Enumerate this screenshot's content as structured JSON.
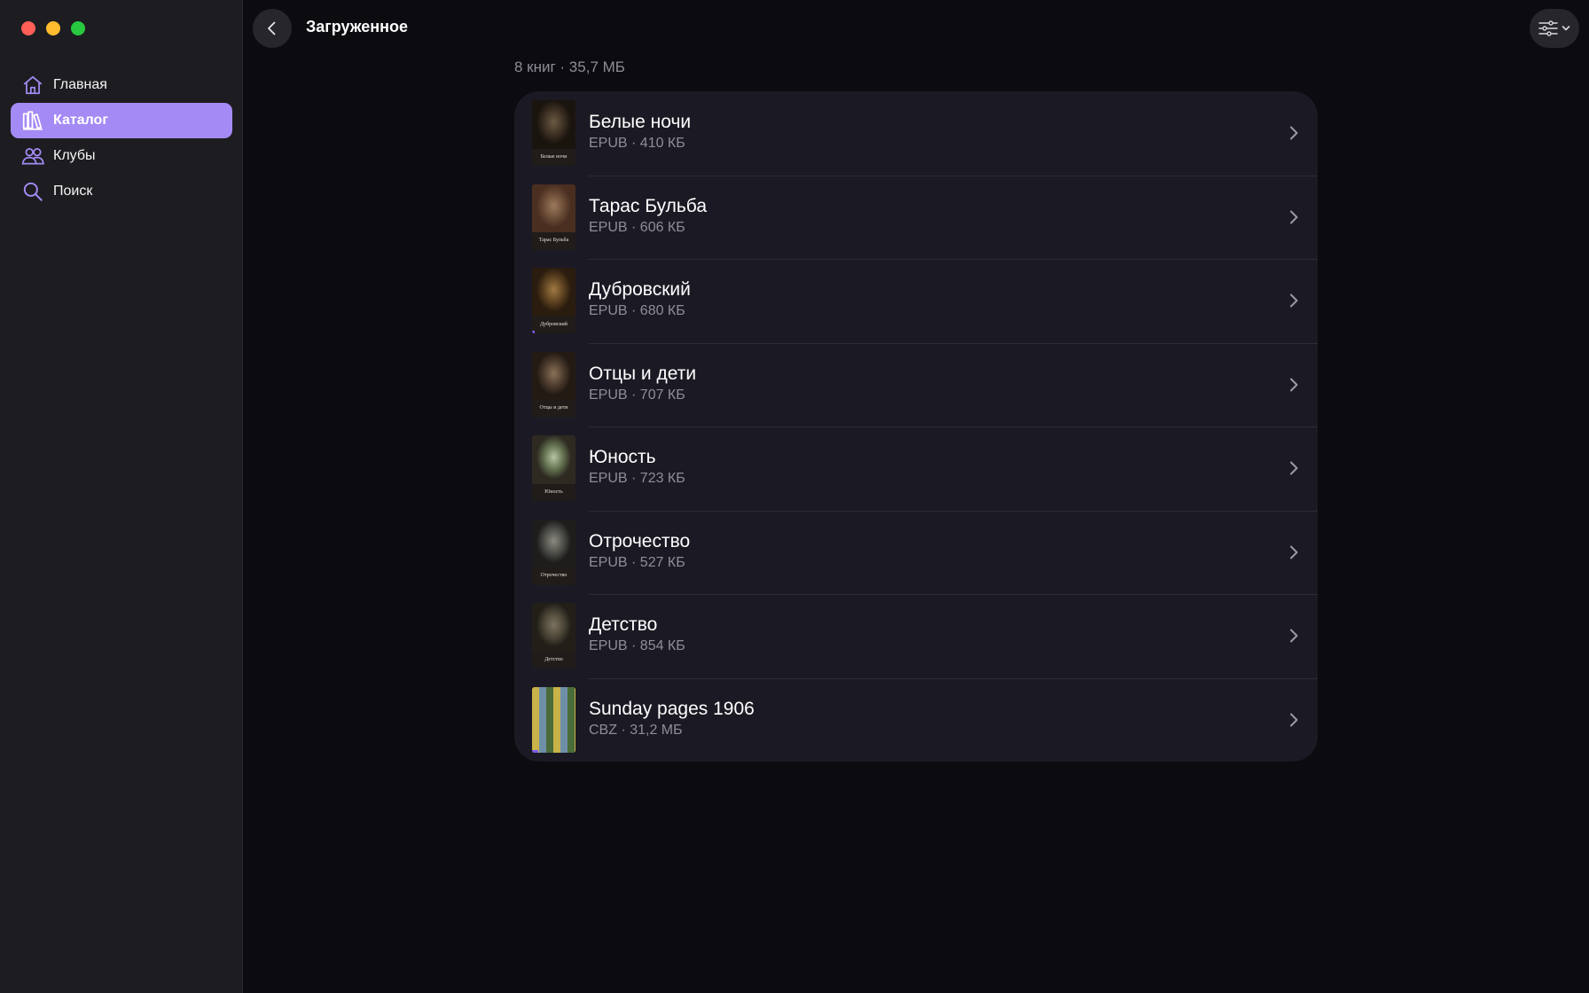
{
  "window": {
    "controls": [
      "close",
      "minimize",
      "maximize"
    ]
  },
  "sidebar": {
    "items": [
      {
        "label": "Главная",
        "icon": "home-icon",
        "active": false
      },
      {
        "label": "Каталог",
        "icon": "library-icon",
        "active": true
      },
      {
        "label": "Клубы",
        "icon": "people-icon",
        "active": false
      },
      {
        "label": "Поиск",
        "icon": "search-icon",
        "active": false
      }
    ]
  },
  "header": {
    "title": "Загруженное",
    "back_icon": "chevron-left-icon",
    "filter_icon": "sliders-icon"
  },
  "summary": "8 книг · 35,7 МБ",
  "books": [
    {
      "title": "Белые ночи",
      "meta": "EPUB · 410 КБ",
      "cover_caption": "Белые ночи",
      "progress": 0
    },
    {
      "title": "Тарас Бульба",
      "meta": "EPUB · 606 КБ",
      "cover_caption": "Тарас Бульба",
      "progress": 0
    },
    {
      "title": "Дубровский",
      "meta": "EPUB · 680 КБ",
      "cover_caption": "Дубровский",
      "progress": 0.05
    },
    {
      "title": "Отцы и дети",
      "meta": "EPUB · 707 КБ",
      "cover_caption": "Отцы и дети",
      "progress": 0
    },
    {
      "title": "Юность",
      "meta": "EPUB · 723 КБ",
      "cover_caption": "Юность",
      "progress": 0
    },
    {
      "title": "Отрочество",
      "meta": "EPUB · 527 КБ",
      "cover_caption": "Отрочество",
      "progress": 0
    },
    {
      "title": "Детство",
      "meta": "EPUB · 854 КБ",
      "cover_caption": "Детство",
      "progress": 0
    },
    {
      "title": "Sunday pages 1906",
      "meta": "CBZ · 31,2 МБ",
      "cover_caption": "",
      "progress": 0.15
    }
  ],
  "colors": {
    "accent": "#a48af4",
    "progress": "#7b5cf0",
    "background": "#0b0b10",
    "sidebar": "#1d1d21",
    "list": "#1b1a24"
  }
}
